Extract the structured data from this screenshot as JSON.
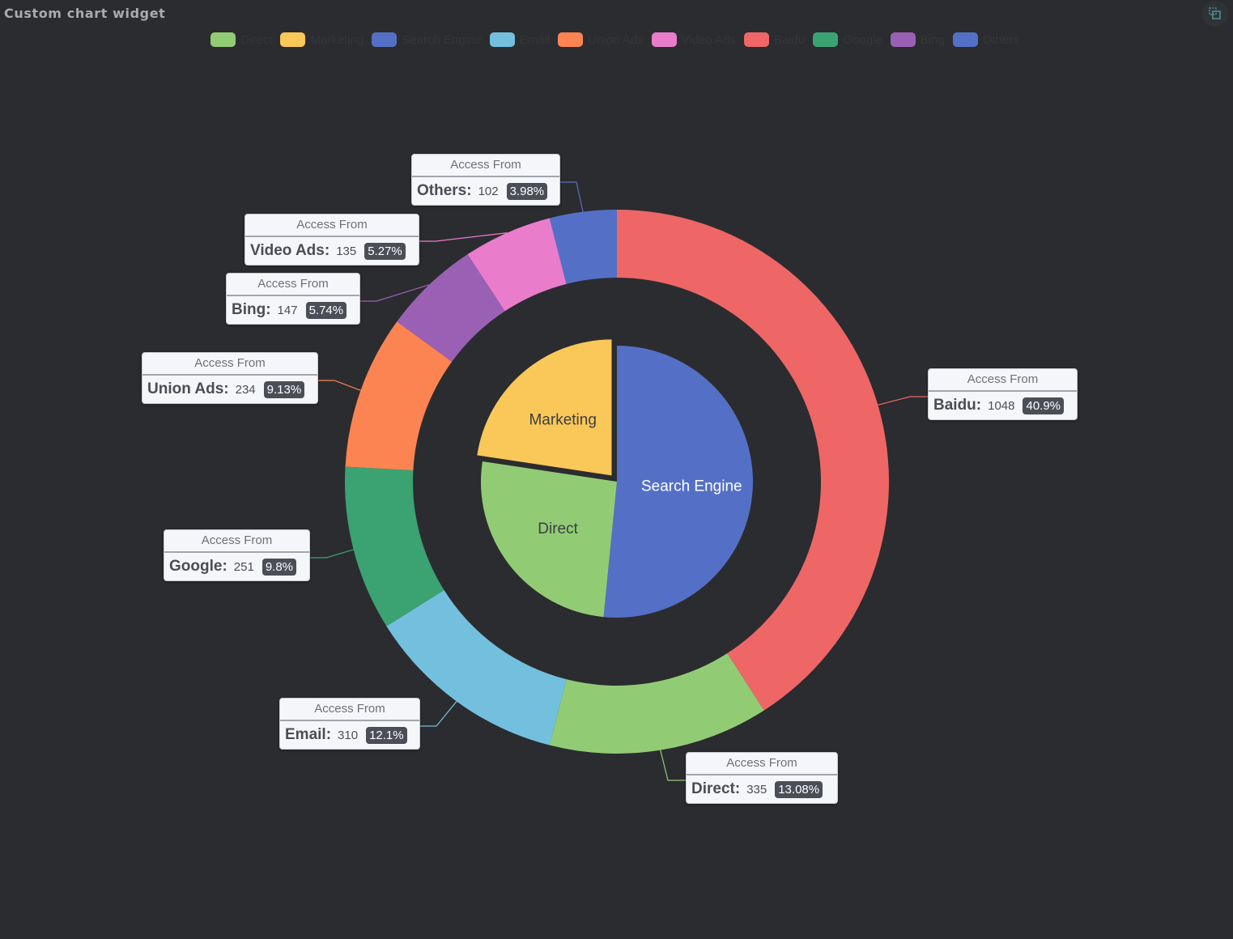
{
  "widget": {
    "title": "Custom chart widget",
    "corner_icon": "copy-layout-icon"
  },
  "chart_data": {
    "type": "pie",
    "title": "Custom chart widget",
    "tooltip_title": "Access From",
    "legend": {
      "placement": "top-center",
      "items": [
        {
          "name": "Direct",
          "color": "#91cc75"
        },
        {
          "name": "Marketing",
          "color": "#fac858"
        },
        {
          "name": "Search Engine",
          "color": "#5470c6"
        },
        {
          "name": "Email",
          "color": "#73c0de"
        },
        {
          "name": "Union Ads",
          "color": "#fc8452"
        },
        {
          "name": "Video Ads",
          "color": "#ea7ccc"
        },
        {
          "name": "Baidu",
          "color": "#ee6666"
        },
        {
          "name": "Google",
          "color": "#3ba272"
        },
        {
          "name": "Bing",
          "color": "#9a60b4"
        },
        {
          "name": "Others",
          "color": "#5470c6"
        }
      ]
    },
    "series": [
      {
        "name": "Access From (inner)",
        "kind": "pie",
        "data": [
          {
            "name": "Search Engine",
            "value": 1548,
            "color": "#5470c6",
            "label_color": "#ffffff"
          },
          {
            "name": "Direct",
            "value": 775,
            "color": "#91cc75",
            "label_color": "#3b3d42"
          },
          {
            "name": "Marketing",
            "value": 679,
            "color": "#fac858",
            "label_color": "#3b3d42",
            "selected": true
          }
        ]
      },
      {
        "name": "Access From (outer)",
        "kind": "ring",
        "data": [
          {
            "name": "Baidu",
            "value": 1048,
            "percent": "40.9%",
            "color": "#ee6666"
          },
          {
            "name": "Direct",
            "value": 335,
            "percent": "13.08%",
            "color": "#91cc75"
          },
          {
            "name": "Email",
            "value": 310,
            "percent": "12.1%",
            "color": "#73c0de"
          },
          {
            "name": "Google",
            "value": 251,
            "percent": "9.8%",
            "color": "#3ba272"
          },
          {
            "name": "Union Ads",
            "value": 234,
            "percent": "9.13%",
            "color": "#fc8452"
          },
          {
            "name": "Bing",
            "value": 147,
            "percent": "5.74%",
            "color": "#9a60b4"
          },
          {
            "name": "Video Ads",
            "value": 135,
            "percent": "5.27%",
            "color": "#ea7ccc"
          },
          {
            "name": "Others",
            "value": 102,
            "percent": "3.98%",
            "color": "#5470c6"
          }
        ]
      }
    ]
  }
}
